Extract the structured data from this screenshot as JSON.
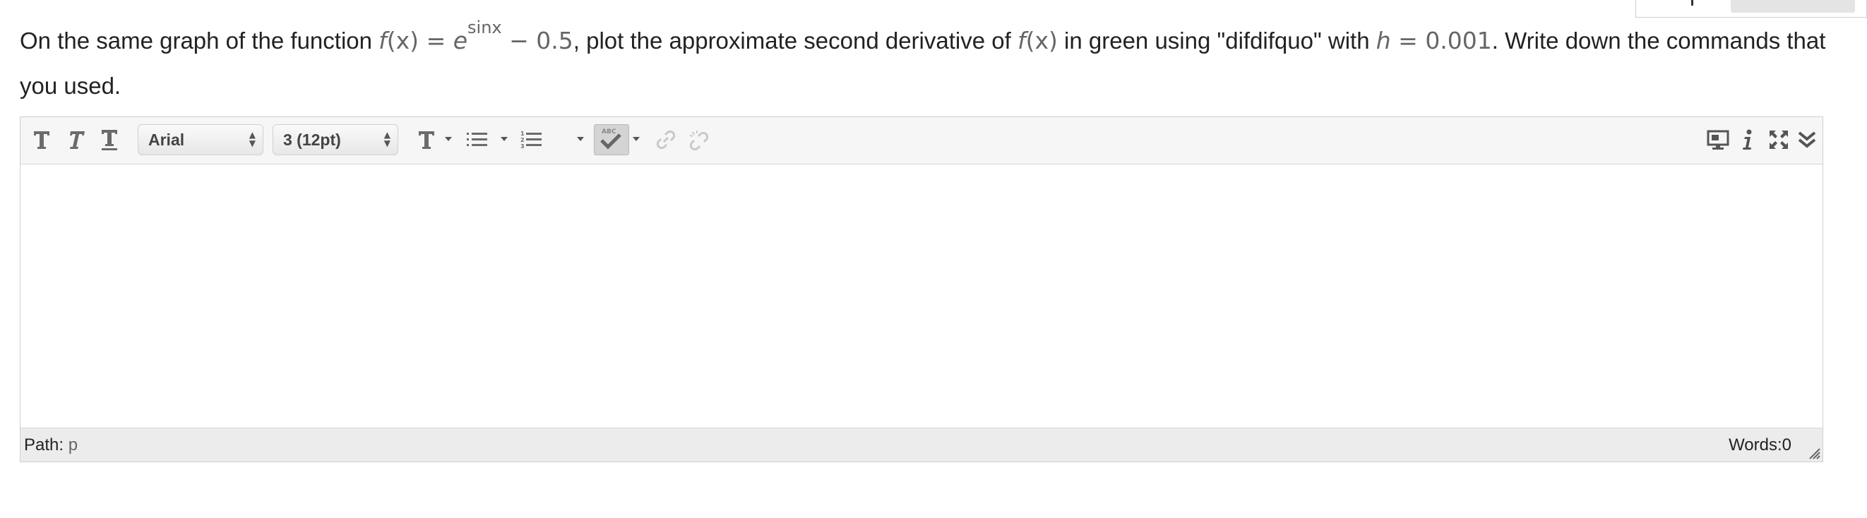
{
  "question": {
    "part1": "On the same graph of the function ",
    "f": "f",
    "x_paren": "(x)",
    "equals": "=",
    "e": "e",
    "exp": "sinx",
    "minus_const": "− 0.5",
    "part2": ", plot the approximate second derivative of ",
    "f2": "f",
    "x_paren2": "(x)",
    "part3": " in green using \"difdifquo\" with ",
    "h": "h",
    "h_eq": "=",
    "h_val": "0.001",
    "part4": ". Write down the commands that you used."
  },
  "toolbar": {
    "font_family": "Arial",
    "font_size": "3 (12pt)",
    "select_arrows": "▲▼"
  },
  "editor": {
    "content": ""
  },
  "statusbar": {
    "path_label": "Path: ",
    "path_value": "p",
    "words": "Words:0"
  }
}
